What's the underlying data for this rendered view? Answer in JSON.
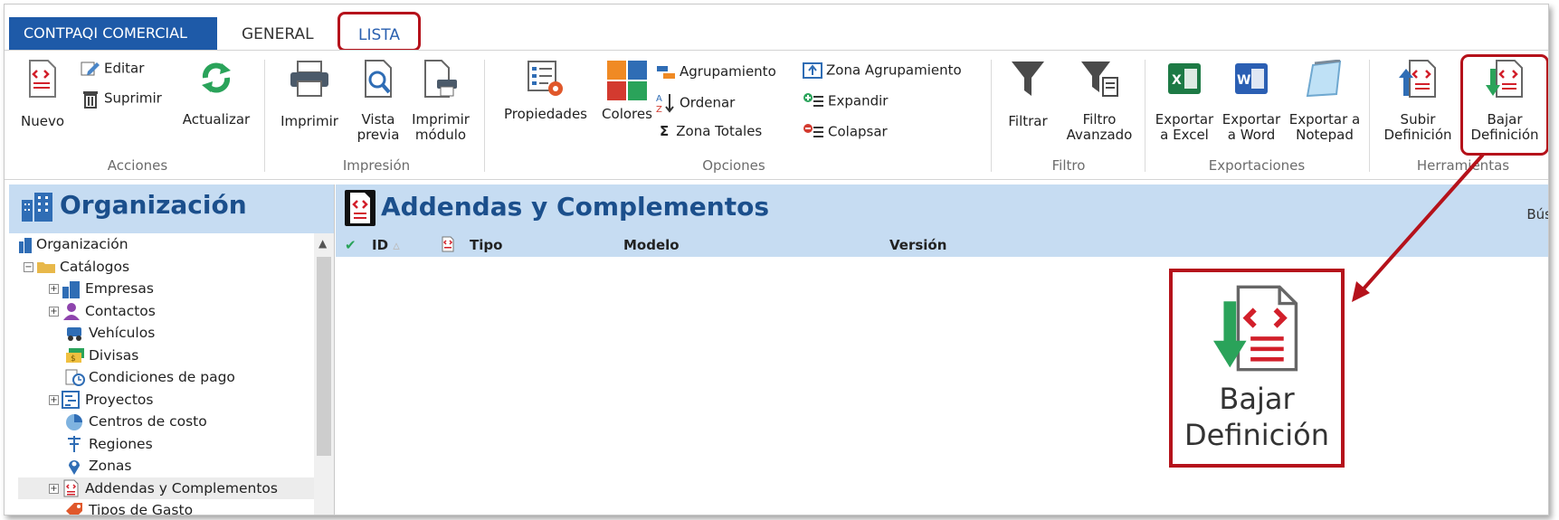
{
  "tabs": {
    "app": "CONTPAQI COMERCIAL",
    "general": "GENERAL",
    "lista": "LISTA"
  },
  "ribbon": {
    "acciones": {
      "label": "Acciones",
      "nuevo": "Nuevo",
      "editar": "Editar",
      "suprimir": "Suprimir",
      "actualizar": "Actualizar"
    },
    "impresion": {
      "label": "Impresión",
      "imprimir": "Imprimir",
      "vista1": "Vista",
      "vista2": "previa",
      "modulo1": "Imprimir",
      "modulo2": "módulo"
    },
    "opciones": {
      "label": "Opciones",
      "propiedades": "Propiedades",
      "colores": "Colores",
      "agrupamiento": "Agrupamiento",
      "ordenar": "Ordenar",
      "zona_totales": "Zona Totales",
      "zona_agrupamiento": "Zona Agrupamiento",
      "expandir": "Expandir",
      "colapsar": "Colapsar"
    },
    "filtro": {
      "label": "Filtro",
      "filtrar": "Filtrar",
      "avanzado1": "Filtro",
      "avanzado2": "Avanzado"
    },
    "exportaciones": {
      "label": "Exportaciones",
      "excel1": "Exportar",
      "excel2": "a Excel",
      "word1": "Exportar",
      "word2": "a Word",
      "notepad1": "Exportar a",
      "notepad2": "Notepad"
    },
    "herramientas": {
      "label": "Herramientas",
      "subir1": "Subir",
      "subir2": "Definición",
      "bajar1": "Bajar",
      "bajar2": "Definición"
    }
  },
  "left_panel": {
    "title": "Organización",
    "tree": [
      "Organización",
      "Catálogos",
      "Empresas",
      "Contactos",
      "Vehículos",
      "Divisas",
      "Condiciones de pago",
      "Proyectos",
      "Centros de costo",
      "Regiones",
      "Zonas",
      "Addendas y Complementos",
      "Tipos de Gasto"
    ]
  },
  "main": {
    "title": "Addendas y Complementos",
    "search_label": "Bús",
    "columns": {
      "id": "ID",
      "tipo": "Tipo",
      "modelo": "Modelo",
      "version": "Versión"
    }
  },
  "callout": {
    "line1": "Bajar",
    "line2": "Definición"
  },
  "colors": {
    "accent": "#1e5aa8",
    "highlight": "#b5121b",
    "header_bg": "#c6dcf2"
  }
}
